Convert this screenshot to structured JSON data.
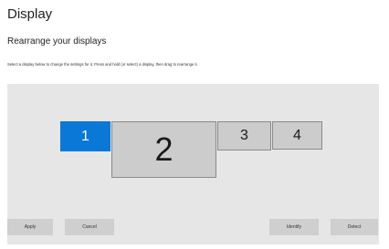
{
  "header": {
    "title": "Display"
  },
  "section": {
    "title": "Rearrange your displays",
    "instructions": "Select a display below to change the settings for it. Press and hold (or select) a display, then drag to rearrange it."
  },
  "displays": [
    {
      "number": "1",
      "selected": true
    },
    {
      "number": "2",
      "selected": false
    },
    {
      "number": "3",
      "selected": false
    },
    {
      "number": "4",
      "selected": false
    }
  ],
  "buttons": {
    "apply": "Apply",
    "cancel": "Cancel",
    "identify": "Identify",
    "detect": "Detect"
  },
  "colors": {
    "selected_display": "#0a78d7",
    "display": "#cccccc",
    "arrange_background": "#e6e6e6",
    "button": "#cfcfcf"
  }
}
